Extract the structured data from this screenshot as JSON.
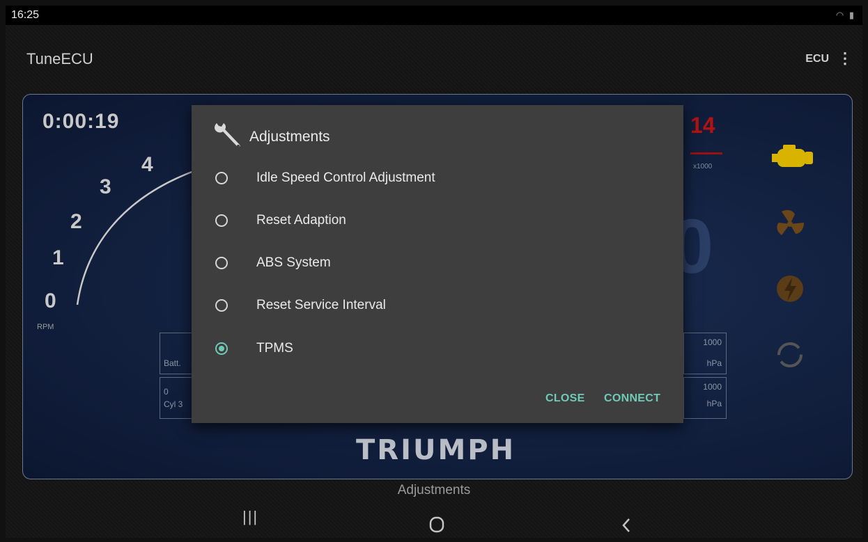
{
  "status_bar": {
    "time": "16:25"
  },
  "app_bar": {
    "title": "TuneECU",
    "ecu_label": "ECU"
  },
  "dashboard": {
    "timer": "0:00:19",
    "rpm_scale": [
      "0",
      "1",
      "2",
      "3",
      "4"
    ],
    "rpm_label": "RPM",
    "gear_value": "14",
    "rpm_multiplier": "x1000",
    "boxes": {
      "left_top": "Batt.",
      "left_bottom_value": "0",
      "left_bottom_label": "Cyl 3",
      "right_top_value": "1000",
      "right_top_unit": "hPa",
      "right_bottom_value": "1000",
      "right_bottom_unit": "hPa"
    },
    "brand": "TRIUMPH"
  },
  "dialog": {
    "title": "Adjustments",
    "options": [
      {
        "label": "Idle Speed Control Adjustment",
        "selected": false
      },
      {
        "label": "Reset Adaption",
        "selected": false
      },
      {
        "label": "ABS System",
        "selected": false
      },
      {
        "label": "Reset Service Interval",
        "selected": false
      },
      {
        "label": "TPMS",
        "selected": true
      }
    ],
    "close_label": "CLOSE",
    "connect_label": "CONNECT"
  },
  "footer_label": "Adjustments",
  "colors": {
    "accent": "#6fcab7",
    "gear_red": "#b31212",
    "engine_icon": "#d8b400"
  },
  "icons": [
    "wifi-icon",
    "battery-icon",
    "overflow-menu-icon",
    "wrench-icon",
    "engine-icon",
    "fan-icon",
    "power-icon",
    "refresh-icon",
    "recents-icon",
    "home-icon",
    "back-icon"
  ]
}
